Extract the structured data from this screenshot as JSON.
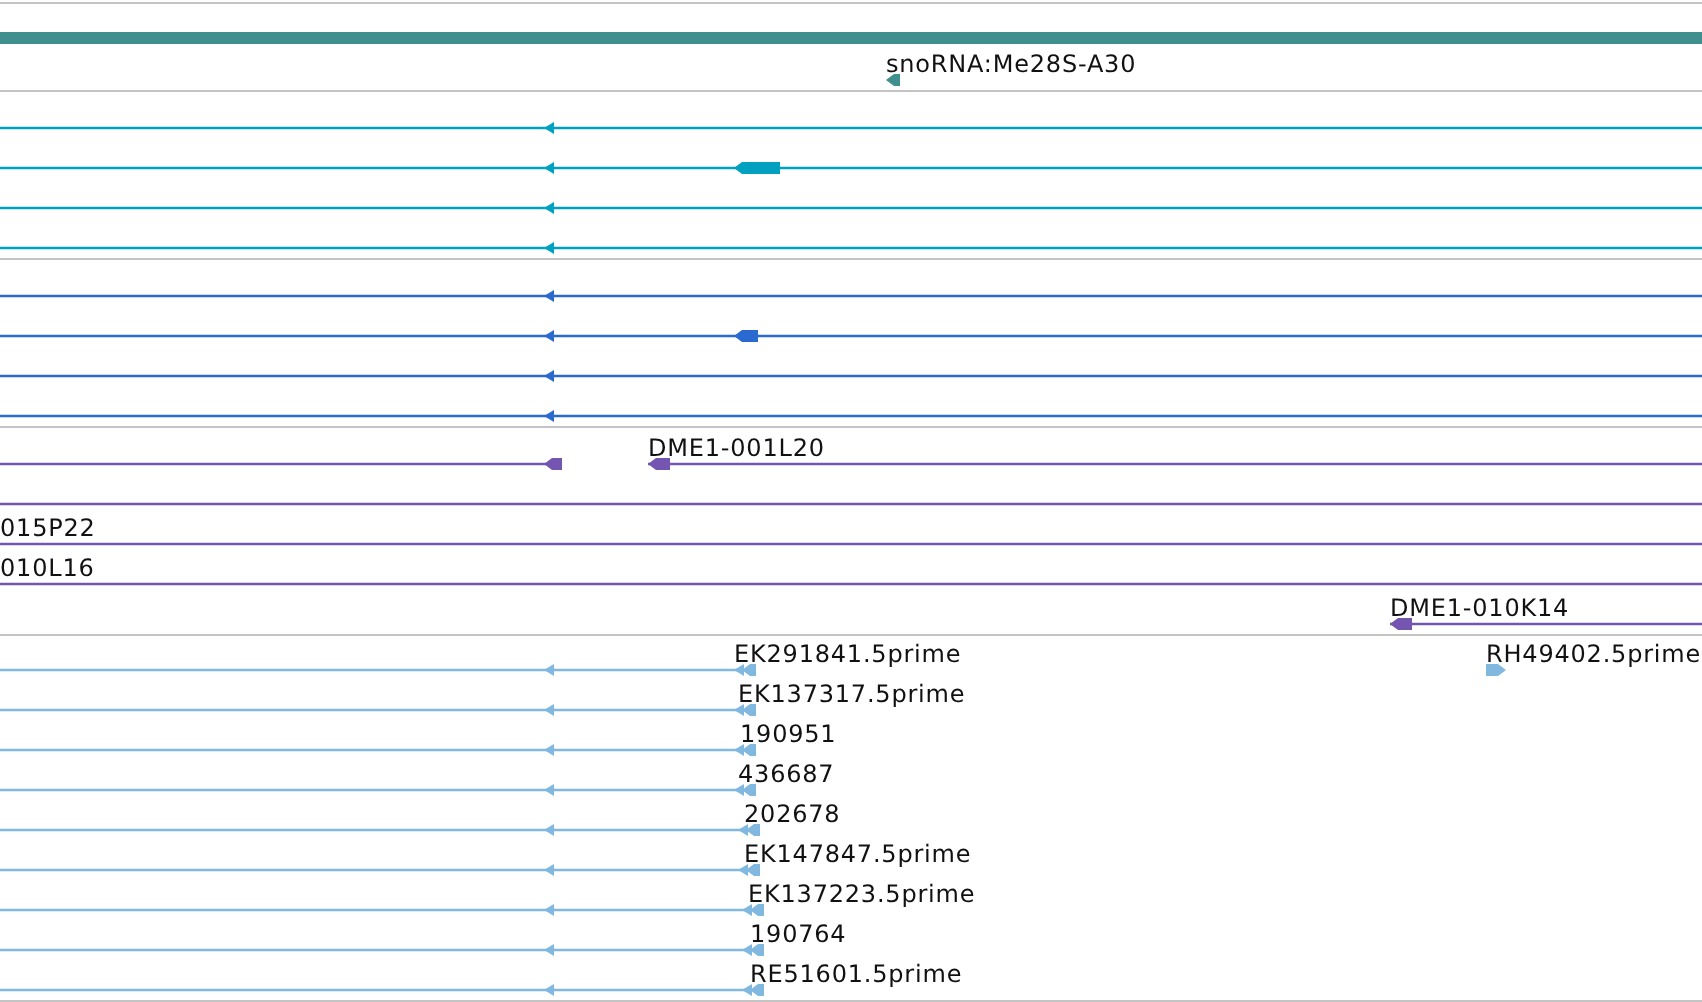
{
  "tracks": [
    {
      "color": "#3f8f8f",
      "rows": [
        {
          "features": [
            {
              "label": "snoRNA:Me28S-A30",
              "reverse": true
            }
          ]
        }
      ]
    },
    {
      "color": "#00a0c0",
      "rows": [
        {
          "features": [
            {
              "reverse": true
            }
          ]
        },
        {
          "features": [
            {
              "reverse": true
            }
          ]
        },
        {
          "features": [
            {
              "reverse": true
            }
          ]
        },
        {
          "features": [
            {
              "reverse": true
            }
          ]
        }
      ]
    },
    {
      "color": "#2a6ad0",
      "rows": [
        {
          "features": [
            {
              "reverse": true
            }
          ]
        },
        {
          "features": [
            {
              "reverse": true
            }
          ]
        },
        {
          "features": [
            {
              "reverse": true
            }
          ]
        },
        {
          "features": [
            {
              "reverse": true
            }
          ]
        }
      ]
    },
    {
      "color": "#7456b0",
      "rows": [
        {
          "features": [
            {
              "kind": "ended",
              "reverse": true
            },
            {
              "kind": "ended",
              "label": "DME1-001L20",
              "reverse": true
            }
          ]
        },
        {
          "features": [
            {
              "kind": "plain"
            }
          ]
        },
        {
          "features": [
            {
              "kind": "plain",
              "label": "015P22"
            }
          ]
        },
        {
          "features": [
            {
              "kind": "plain",
              "label": "010L16"
            }
          ]
        },
        {
          "features": [
            {
              "kind": "ended",
              "label": "DME1-010K14",
              "reverse": true
            }
          ]
        }
      ]
    },
    {
      "color": "#80b8e0",
      "rows": [
        {
          "features": [
            {
              "label": "EK291841.5prime",
              "reverse": true
            },
            {
              "label": "RH49402.5prime",
              "reverse": false
            }
          ]
        },
        {
          "features": [
            {
              "label": "EK137317.5prime",
              "reverse": true
            }
          ]
        },
        {
          "features": [
            {
              "label": "190951",
              "reverse": true
            }
          ]
        },
        {
          "features": [
            {
              "label": "436687",
              "reverse": true
            }
          ]
        },
        {
          "features": [
            {
              "label": "202678",
              "reverse": true
            }
          ]
        },
        {
          "features": [
            {
              "label": "EK147847.5prime",
              "reverse": true
            }
          ]
        },
        {
          "features": [
            {
              "label": "EK137223.5prime",
              "reverse": true
            }
          ]
        },
        {
          "features": [
            {
              "label": "190764",
              "reverse": true
            }
          ]
        },
        {
          "features": [
            {
              "label": "RE51601.5prime",
              "reverse": true
            }
          ]
        }
      ]
    }
  ]
}
